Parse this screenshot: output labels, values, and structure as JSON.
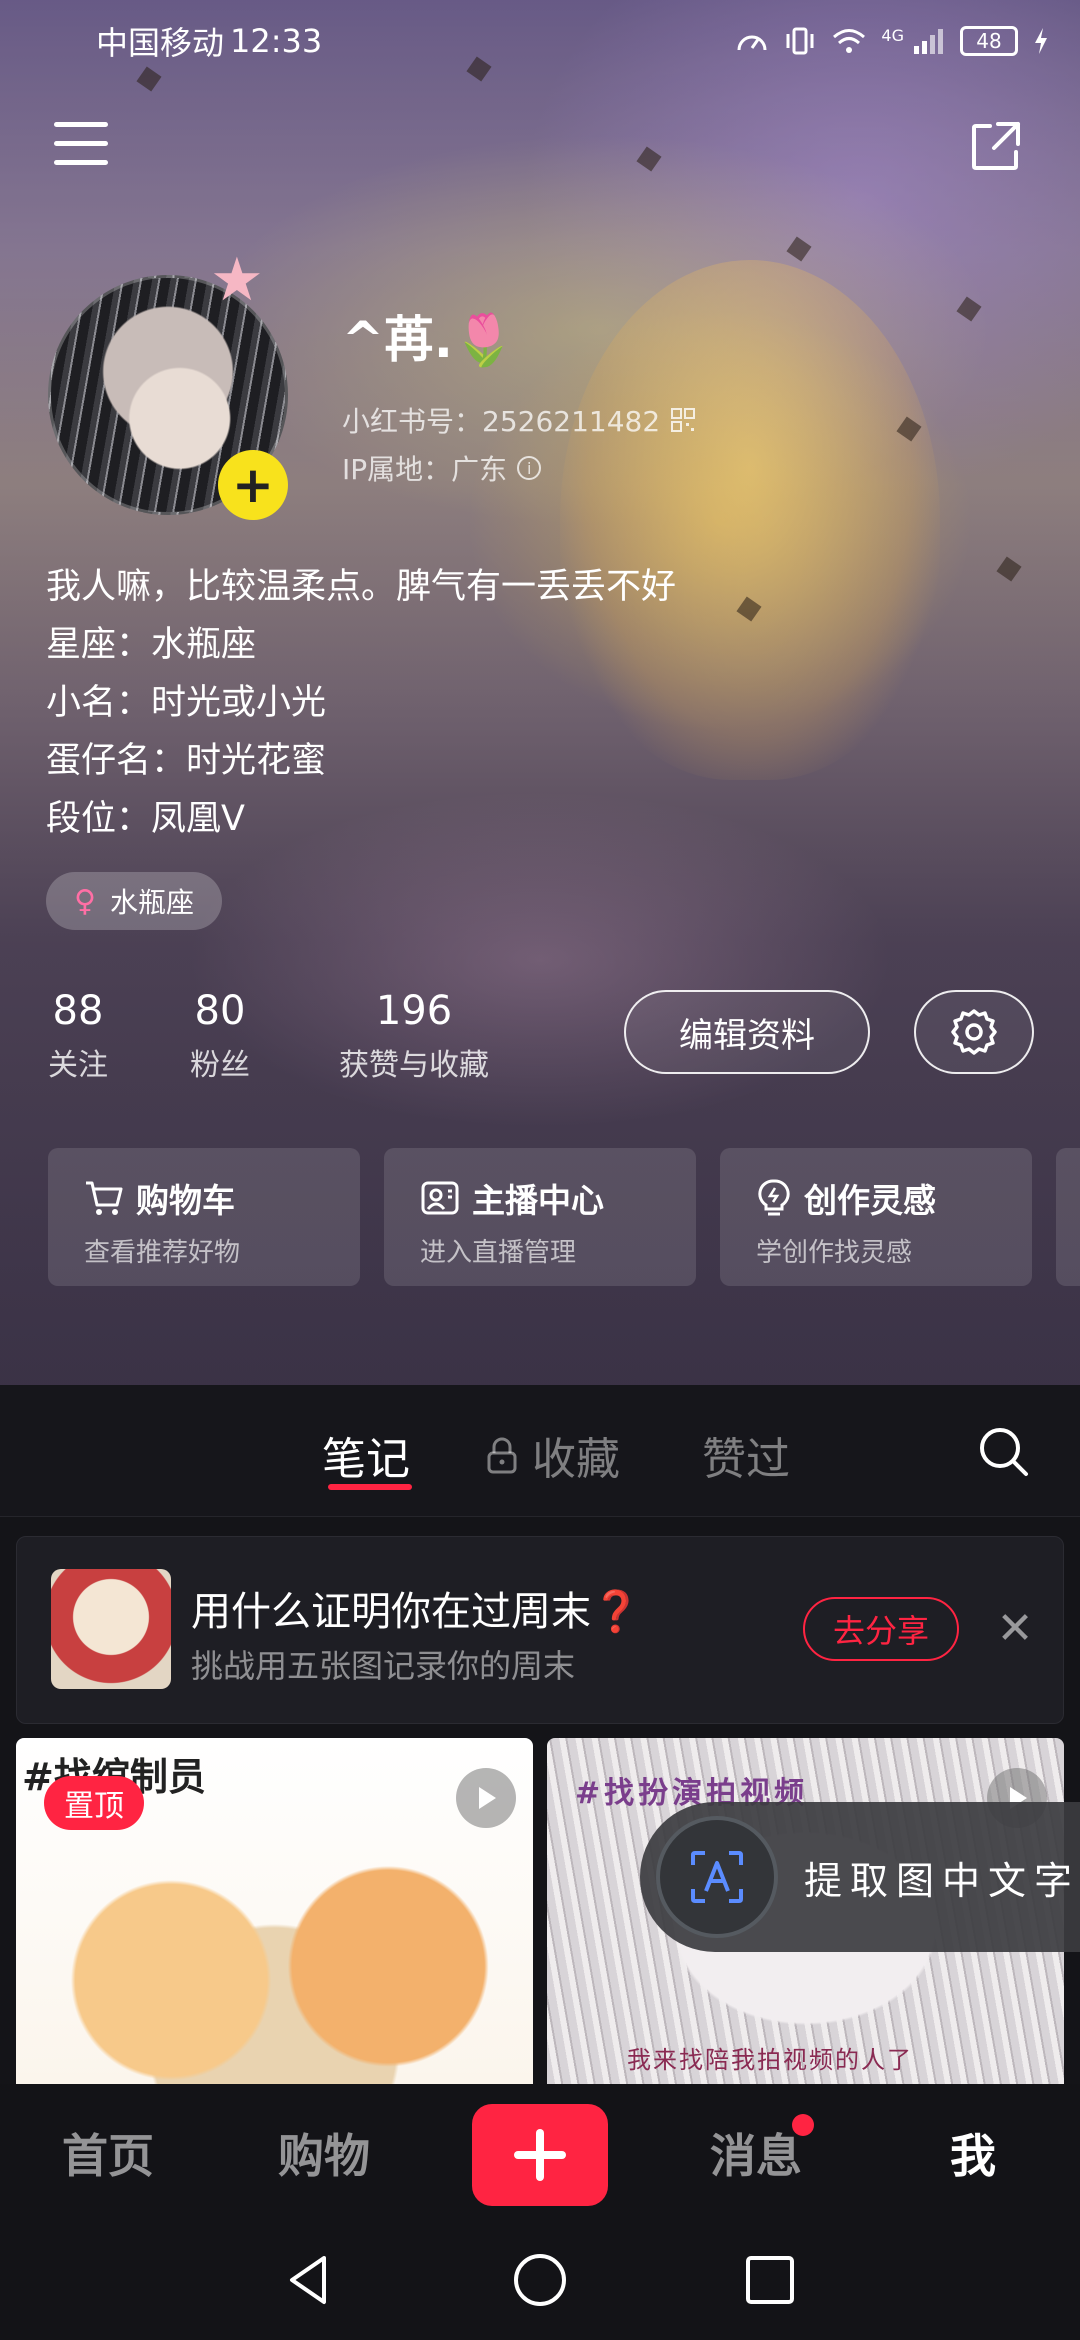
{
  "status_bar": {
    "carrier": "中国移动",
    "time": "12:33",
    "network": "4G",
    "battery": "48"
  },
  "profile": {
    "nickname": "^苒.🌷",
    "id_label": "小红书号：",
    "id_value": "2526211482",
    "ip_label": "IP属地：",
    "ip_value": "广东",
    "bio": [
      "我人嘛，比较温柔点。脾气有一丢丢不好",
      "星座：水瓶座",
      "小名：时光或小光",
      "蛋仔名：时光花蜜",
      "段位：凤凰V"
    ],
    "zodiac_tag": "水瓶座"
  },
  "stats": [
    {
      "value": "88",
      "label": "关注"
    },
    {
      "value": "80",
      "label": "粉丝"
    },
    {
      "value": "196",
      "label": "获赞与收藏"
    }
  ],
  "actions": {
    "edit_profile": "编辑资料"
  },
  "quick_cards": [
    {
      "title": "购物车",
      "subtitle": "查看推荐好物",
      "icon": "cart-icon"
    },
    {
      "title": "主播中心",
      "subtitle": "进入直播管理",
      "icon": "streamer-icon"
    },
    {
      "title": "创作灵感",
      "subtitle": "学创作找灵感",
      "icon": "bulb-icon"
    }
  ],
  "tabs": [
    {
      "label": "笔记",
      "active": true
    },
    {
      "label": "收藏",
      "locked": true
    },
    {
      "label": "赞过"
    }
  ],
  "banner": {
    "title": "用什么证明你在过周末❓",
    "subtitle": "挑战用五张图记录你的周末",
    "button": "去分享"
  },
  "notes": [
    {
      "title": "#找绾制员",
      "badge": "置顶"
    },
    {
      "title": "#找扮演拍视频",
      "caption": "我来找陪我拍视频的人了"
    }
  ],
  "ocr_float": {
    "label": "提取图中文字"
  },
  "bottom_nav": [
    {
      "label": "首页"
    },
    {
      "label": "购物"
    },
    {
      "label": "消息",
      "has_dot": true
    },
    {
      "label": "我",
      "active": true
    }
  ],
  "colors": {
    "accent": "#ff2442",
    "avatar_plus": "#f8e21c"
  }
}
